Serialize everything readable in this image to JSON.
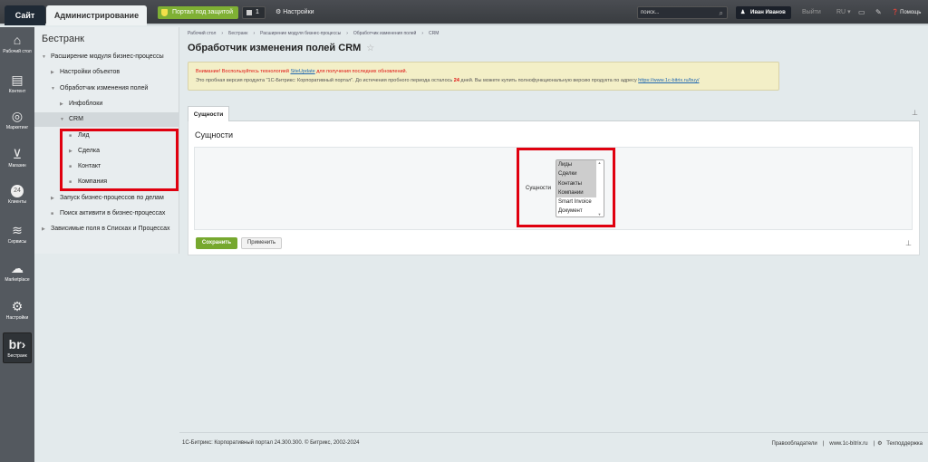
{
  "topbar": {
    "site_tab": "Сайт",
    "admin_tab": "Администрирование",
    "secure_label": "Портал под защитой",
    "notif_count": "1",
    "settings_label": "Настройки",
    "search_placeholder": "поиск...",
    "user_name": "Иван Иванов",
    "logout": "Выйти",
    "lang": "RU",
    "help": "Помощь"
  },
  "rail": [
    {
      "label": "Рабочий стол",
      "icon": "home-icon"
    },
    {
      "label": "Контент",
      "icon": "document-icon"
    },
    {
      "label": "Маркетинг",
      "icon": "target-icon"
    },
    {
      "label": "Магазин",
      "icon": "basket-icon"
    },
    {
      "label": "Клиенты",
      "icon": "clients-icon",
      "glyph": "24"
    },
    {
      "label": "Сервисы",
      "icon": "layers-icon"
    },
    {
      "label": "Marketplace",
      "icon": "cloud-icon"
    },
    {
      "label": "Настройки",
      "icon": "gear-icon"
    },
    {
      "label": "Бестранк",
      "icon": "brand-icon",
      "glyph": "br›"
    }
  ],
  "menu": {
    "title": "Бестранк",
    "items": [
      {
        "label": "Расширение модуля бизнес-процессы",
        "arrow": "▼"
      },
      {
        "label": "Настройки объектов",
        "arrow": "▶"
      },
      {
        "label": "Обработчик изменения полей",
        "arrow": "▼"
      },
      {
        "label": "Инфоблоки",
        "arrow": "▶"
      },
      {
        "label": "CRM",
        "arrow": "▼"
      },
      {
        "label": "Лид",
        "arrow": "■"
      },
      {
        "label": "Сделка",
        "arrow": "▶"
      },
      {
        "label": "Контакт",
        "arrow": "■"
      },
      {
        "label": "Компания",
        "arrow": "■"
      },
      {
        "label": "Запуск бизнес-процессов по делам",
        "arrow": "▶"
      },
      {
        "label": "Поиск активити в бизнес-процессах",
        "arrow": "■"
      },
      {
        "label": "Зависимые поля в Списках и Процессах",
        "arrow": "▶"
      }
    ]
  },
  "breadcrumbs": [
    "Рабочий стол",
    "›",
    "Бестранк",
    "›",
    "Расширение модуля бизнес-процессы",
    "›",
    "Обработчик изменения полей",
    "›",
    "CRM"
  ],
  "page_title": "Обработчик изменения полей CRM",
  "notice": {
    "warn_pre": "Внимание! Воспользуйтесь технологией ",
    "warn_link": "SiteUpdate",
    "warn_post": " для получения последних обновлений.",
    "trial_pre": "Это пробная версия продукта \"1С-Битрикс: Корпоративный портал\". До истечения пробного периода осталось ",
    "days": "24",
    "trial_mid": " дней. Вы можете купить полнофункциональную версию продукта по адресу ",
    "trial_link": "https://www.1c-bitrix.ru/buy/"
  },
  "tab": "Сущности",
  "section_title": "Сущности",
  "field_label": "Сущности",
  "options": [
    {
      "label": "Лиды",
      "selected": true
    },
    {
      "label": "Сделки",
      "selected": true
    },
    {
      "label": "Контакты",
      "selected": true
    },
    {
      "label": "Компании",
      "selected": true
    },
    {
      "label": "Smart Invoice",
      "selected": false
    },
    {
      "label": "Документ",
      "selected": false
    }
  ],
  "buttons": {
    "save": "Сохранить",
    "apply": "Применить"
  },
  "footer": {
    "left": "1С-Битрикс: Корпоративный портал 24.300.300. © Битрикс, 2002-2024",
    "links": [
      "Правообладатели",
      "|",
      "www.1c-bitrix.ru",
      "|",
      "Техподдержка"
    ]
  }
}
